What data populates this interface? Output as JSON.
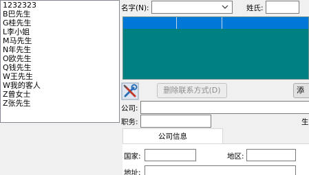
{
  "contacts": [
    "1232323",
    "B巴先生",
    "G桂先生",
    "L李小姐",
    "M马先生",
    "N年先生",
    "O欧先生",
    "Q钱先生",
    "W王先生",
    "W我的客人",
    "Z曾女士",
    "Z张先生"
  ],
  "filter": {
    "name_label": "名字(N):",
    "name_value": "",
    "surname_label": "姓氏:",
    "surname_value": ""
  },
  "toolbar": {
    "tool_icon": "tools-icon",
    "delete_contact_label": "删除联系方式(D)",
    "add_label": "添"
  },
  "form": {
    "company_label": "公司:",
    "company_value": "",
    "title_label": "职务:",
    "title_value": "",
    "cut_label": "生日"
  },
  "tabs": [
    "公司信息",
    ""
  ],
  "company_tab": {
    "country_label": "国家:",
    "region_label": "地区:",
    "address_label": "地址:"
  },
  "colors": {
    "grid_bg": "#008080",
    "grid_header": "#0078d7"
  }
}
